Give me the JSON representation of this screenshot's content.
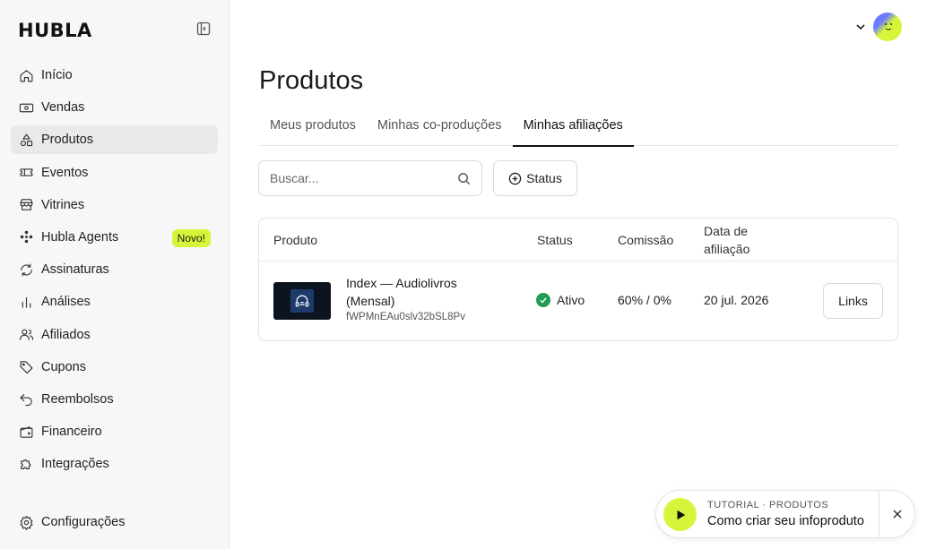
{
  "app": {
    "logo": "HUBLA"
  },
  "sidebar": {
    "items": [
      {
        "label": "Início",
        "icon": "home-icon"
      },
      {
        "label": "Vendas",
        "icon": "money-icon"
      },
      {
        "label": "Produtos",
        "icon": "shapes-icon",
        "active": true
      },
      {
        "label": "Eventos",
        "icon": "ticket-icon"
      },
      {
        "label": "Vitrines",
        "icon": "store-icon"
      },
      {
        "label": "Hubla Agents",
        "icon": "agents-icon",
        "badge": "Novo!"
      },
      {
        "label": "Assinaturas",
        "icon": "refresh-icon"
      },
      {
        "label": "Análises",
        "icon": "bar-chart-icon"
      },
      {
        "label": "Afiliados",
        "icon": "users-icon"
      },
      {
        "label": "Cupons",
        "icon": "tag-icon"
      },
      {
        "label": "Reembolsos",
        "icon": "undo-icon"
      },
      {
        "label": "Financeiro",
        "icon": "wallet-icon"
      },
      {
        "label": "Integrações",
        "icon": "puzzle-icon"
      }
    ],
    "settings_label": "Configurações"
  },
  "page": {
    "title": "Produtos",
    "tabs": [
      {
        "label": "Meus produtos"
      },
      {
        "label": "Minhas co-produções"
      },
      {
        "label": "Minhas afiliações",
        "active": true
      }
    ]
  },
  "filters": {
    "search_placeholder": "Buscar...",
    "status_label": "Status"
  },
  "table": {
    "headers": {
      "product": "Produto",
      "status": "Status",
      "commission": "Comissão",
      "date_line1": "Data de",
      "date_line2": "afiliação"
    },
    "rows": [
      {
        "name": "Index — Audiolivros (Mensal)",
        "id": "fWPMnEAu0slv32bSL8Pv",
        "status": "Ativo",
        "commission": "60% / 0%",
        "date": "20 jul. 2026",
        "action": "Links"
      }
    ]
  },
  "tutorial": {
    "subtitle": "TUTORIAL · PRODUTOS",
    "title": "Como criar seu infoproduto"
  },
  "colors": {
    "accent": "#d6f53a",
    "status_active": "#1f9d55",
    "sidebar_bg": "#f7f7f7"
  }
}
